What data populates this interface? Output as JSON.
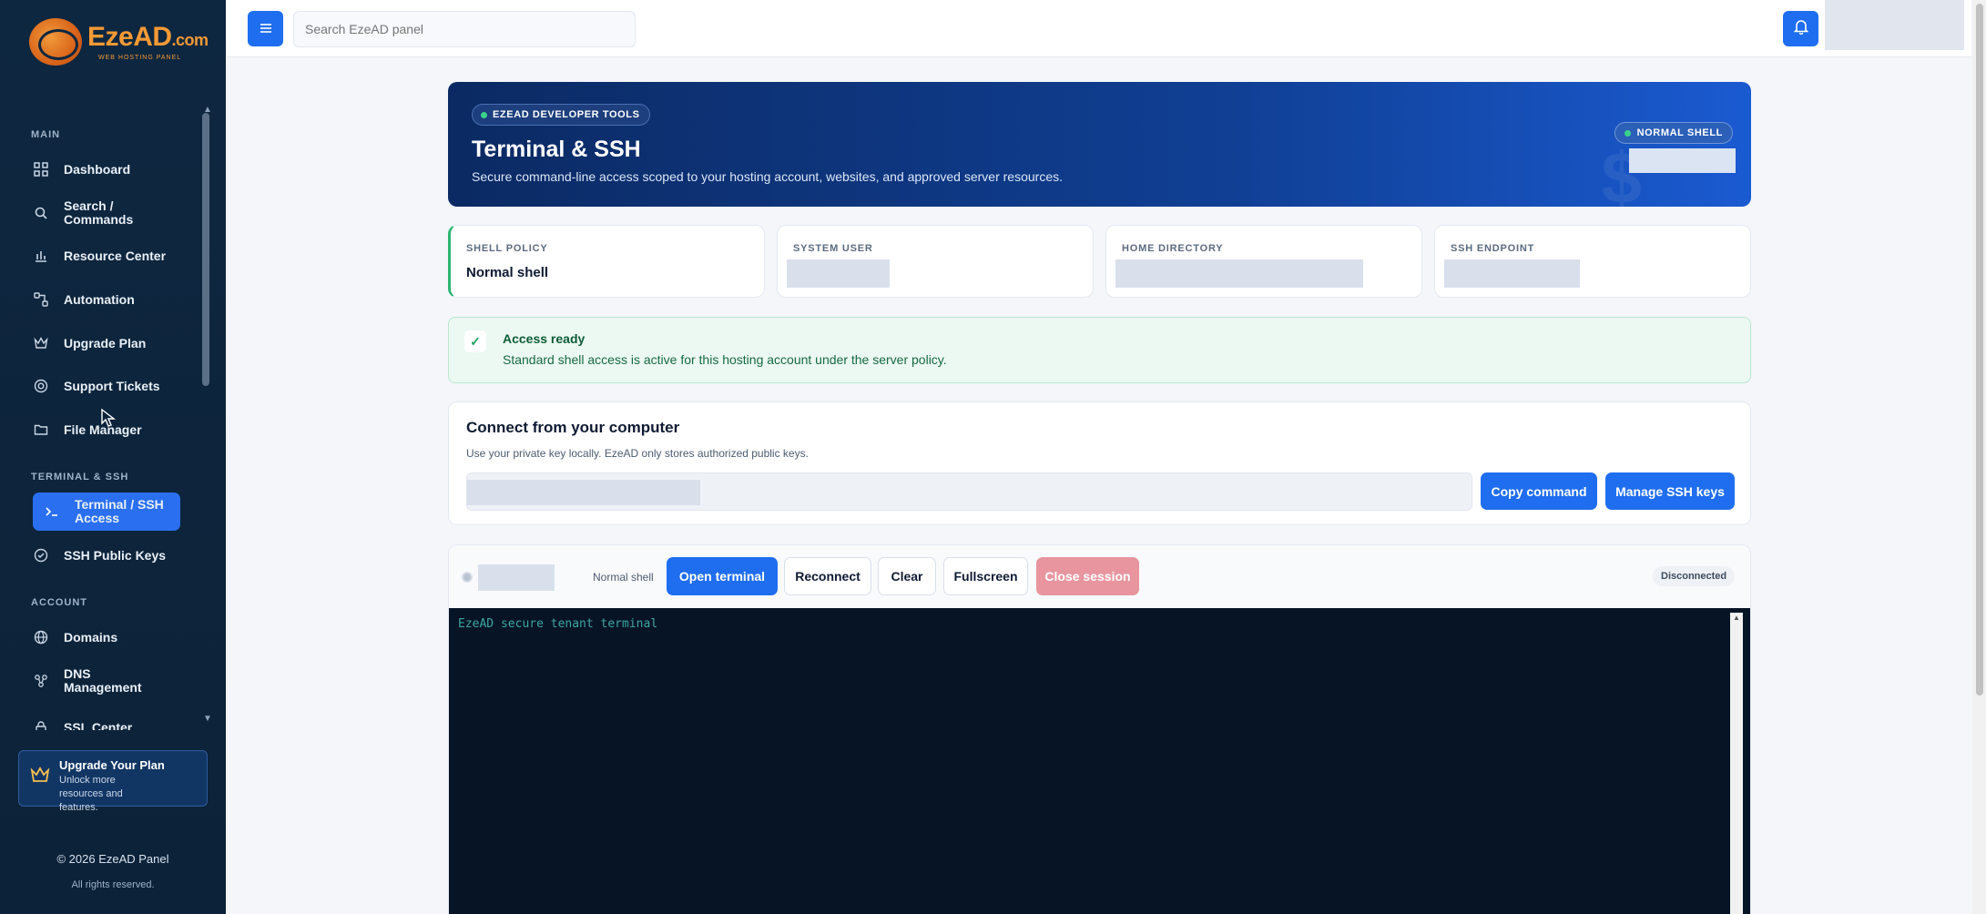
{
  "app": {
    "logo_text": "EzeAD",
    "logo_suffix": ".com",
    "logo_tagline": "WEB HOSTING PANEL"
  },
  "topbar": {
    "search_placeholder": "Search EzeAD panel"
  },
  "sidebar": {
    "sections": {
      "main": "MAIN",
      "terminal": "TERMINAL & SSH",
      "account": "ACCOUNT"
    },
    "items": [
      {
        "label": "Dashboard",
        "icon": "grid-icon"
      },
      {
        "label": "Search / Commands",
        "icon": "search-icon"
      },
      {
        "label": "Resource Center",
        "icon": "bar-chart-icon"
      },
      {
        "label": "Automation",
        "icon": "workflow-icon"
      },
      {
        "label": "Upgrade Plan",
        "icon": "crown-icon"
      },
      {
        "label": "Support Tickets",
        "icon": "lifebuoy-icon"
      },
      {
        "label": "File Manager",
        "icon": "folder-icon"
      },
      {
        "label": "Terminal / SSH Access",
        "icon": "terminal-icon",
        "active": true
      },
      {
        "label": "SSH Public Keys",
        "icon": "check-circle-icon"
      },
      {
        "label": "Domains",
        "icon": "globe-icon"
      },
      {
        "label": "DNS Management",
        "icon": "network-icon"
      },
      {
        "label": "SSL Center",
        "icon": "lock-icon"
      }
    ],
    "upgrade": {
      "title": "Upgrade Your Plan",
      "subtitle": "Unlock more resources and features."
    },
    "copyright": "© 2026 EzeAD Panel",
    "rights": "All rights reserved."
  },
  "hero": {
    "badge": "EZEAD DEVELOPER TOOLS",
    "title": "Terminal & SSH",
    "subtitle": "Secure command-line access scoped to your hosting account, websites, and approved server resources.",
    "shell_badge": "NORMAL SHELL"
  },
  "cards": {
    "shell_policy": {
      "label": "SHELL POLICY",
      "value": "Normal shell"
    },
    "system_user": {
      "label": "SYSTEM USER"
    },
    "home_directory": {
      "label": "HOME DIRECTORY"
    },
    "ssh_endpoint": {
      "label": "SSH ENDPOINT"
    }
  },
  "alert": {
    "title": "Access ready",
    "message": "Standard shell access is active for this hosting account under the server policy."
  },
  "connect": {
    "title": "Connect from your computer",
    "subtitle": "Use your private key locally. EzeAD only stores authorized public keys.",
    "copy_button": "Copy command",
    "manage_button": "Manage SSH keys"
  },
  "terminal": {
    "shell_label": "Normal shell",
    "open_button": "Open terminal",
    "reconnect_button": "Reconnect",
    "clear_button": "Clear",
    "fullscreen_button": "Fullscreen",
    "close_button": "Close session",
    "status": "Disconnected",
    "output_line": "EzeAD secure tenant terminal"
  },
  "colors": {
    "accent": "#1f6ef0",
    "sidebar_bg": "#0e2740",
    "success": "#2bb673",
    "danger_disabled": "#e8959f"
  }
}
